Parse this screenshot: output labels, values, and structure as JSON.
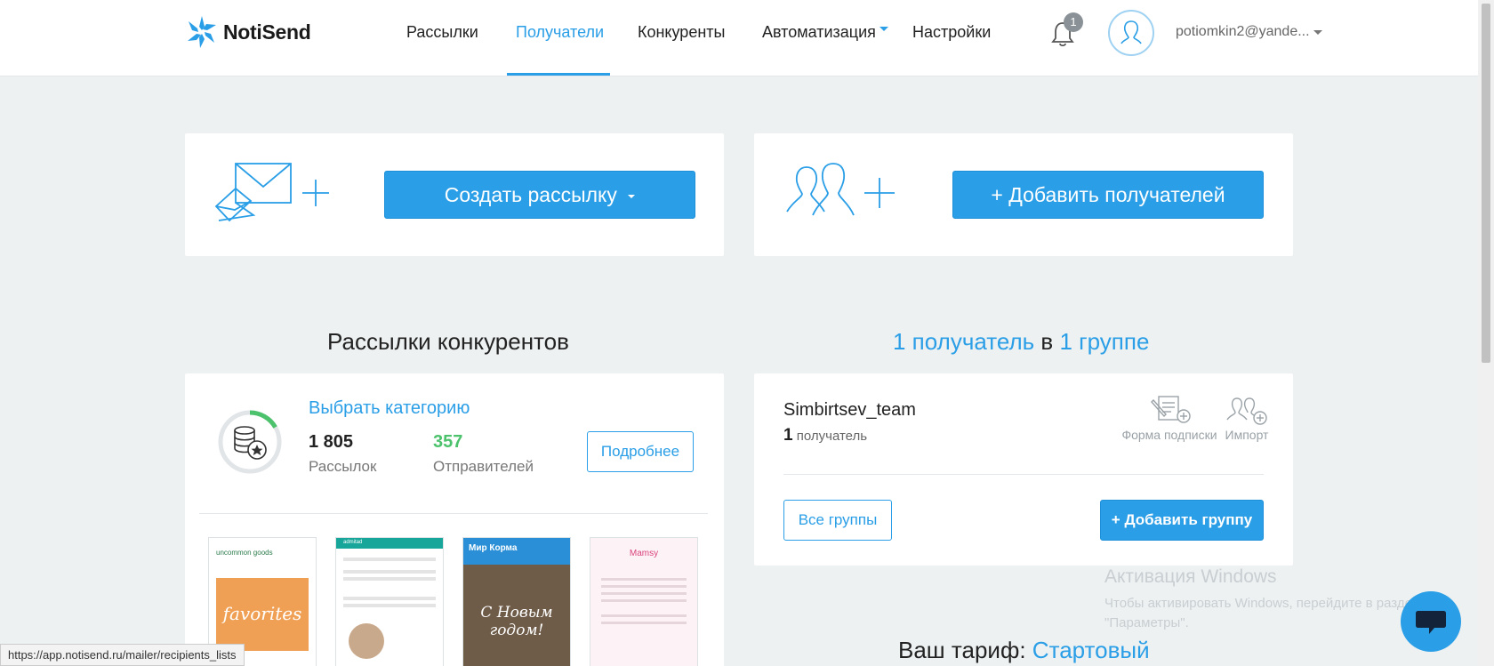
{
  "header": {
    "logo_text": "NotiSend",
    "nav": [
      {
        "label": "Рассылки"
      },
      {
        "label": "Получатели",
        "active": true
      },
      {
        "label": "Конкуренты"
      },
      {
        "label": "Автоматизация"
      },
      {
        "label": "Настройки"
      }
    ],
    "notifications_count": "1",
    "user_email": "potiomkin2@yande..."
  },
  "actions": {
    "create_campaign_label": "Создать рассылку",
    "add_recipients_label": "+ Добавить получателей"
  },
  "competitors": {
    "title": "Рассылки конкурентов",
    "choose_category": "Выбрать категорию",
    "campaigns_count": "1 805",
    "campaigns_label": "Рассылок",
    "senders_count": "357",
    "senders_label": "Отправителей",
    "details_button": "Подробнее",
    "thumbnails": [
      {
        "brand": "uncommon goods",
        "headline": "favorites"
      },
      {
        "brand": "admitad",
        "headline": ""
      },
      {
        "brand": "Мир Корма",
        "headline": "С Новым годом!"
      },
      {
        "brand": "Mamsy",
        "headline": ""
      }
    ]
  },
  "recipients": {
    "count_text": "1 получатель",
    "in_text": "в",
    "groups_text": "1 группе",
    "group_name": "Simbirtsev_team",
    "group_count": "1",
    "group_count_label": "получатель",
    "subscribe_form_label": "Форма подписки",
    "import_label": "Импорт",
    "all_groups_button": "Все группы",
    "add_group_button": "+ Добавить группу"
  },
  "tariff": {
    "label": "Ваш тариф:",
    "value": "Стартовый"
  },
  "status_bar_url": "https://app.notisend.ru/mailer/recipients_lists",
  "windows_watermark": {
    "title": "Активация Windows",
    "line1": "Чтобы активировать Windows, перейдите в раздел",
    "line2": "\"Параметры\"."
  },
  "colors": {
    "accent": "#2a9ee6",
    "green": "#4bc26b",
    "background": "#eef1f2"
  }
}
